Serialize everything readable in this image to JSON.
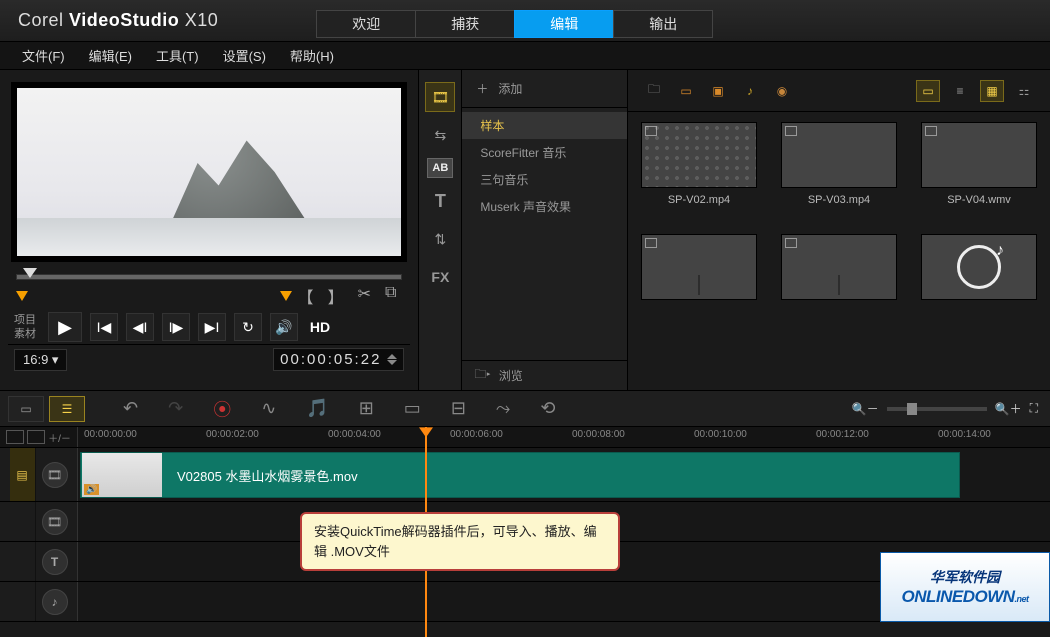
{
  "brand": {
    "b1": "Corel ",
    "b2": "VideoStudio",
    "b3": " X10"
  },
  "maintabs": [
    "欢迎",
    "捕获",
    "编辑",
    "输出"
  ],
  "maintab_active": 2,
  "menus": [
    "文件(F)",
    "编辑(E)",
    "工具(T)",
    "设置(S)",
    "帮助(H)"
  ],
  "preview": {
    "project_label": "项目",
    "clip_label": "素材",
    "hd_label": "HD",
    "aspect": "16:9",
    "timecode": "00:00:05:22"
  },
  "library": {
    "add_label": "添加",
    "items": [
      "样本",
      "ScoreFitter 音乐",
      "三句音乐",
      "Muserk 声音效果"
    ],
    "selected": 0,
    "browse_label": "浏览"
  },
  "rail": [
    "film",
    "swap",
    "ab",
    "T",
    "swap2",
    "FX"
  ],
  "thumbs": [
    {
      "label": "SP-V02.mp4",
      "cls": "p1"
    },
    {
      "label": "SP-V03.mp4",
      "cls": "p2"
    },
    {
      "label": "SP-V04.wmv",
      "cls": "p3"
    },
    {
      "label": "",
      "cls": "p4"
    },
    {
      "label": "",
      "cls": "p5"
    },
    {
      "label": "",
      "cls": "p6"
    }
  ],
  "ruler_ticks": [
    "00:00:00:00",
    "00:00:02:00",
    "00:00:04:00",
    "00:00:06:00",
    "00:00:08:00",
    "00:00:10:00",
    "00:00:12:00",
    "00:00:14:00"
  ],
  "clip_filename": "V02805 水墨山水烟雾景色.mov",
  "tooltip_text": "安装QuickTime解码器插件后，可导入、播放、编辑 .MOV文件",
  "watermark": {
    "cn": "华军软件园",
    "en": "ONLINEDOWN",
    "net": ".net"
  },
  "track_icons": [
    "🎞",
    "🎞",
    "T",
    "♪"
  ]
}
